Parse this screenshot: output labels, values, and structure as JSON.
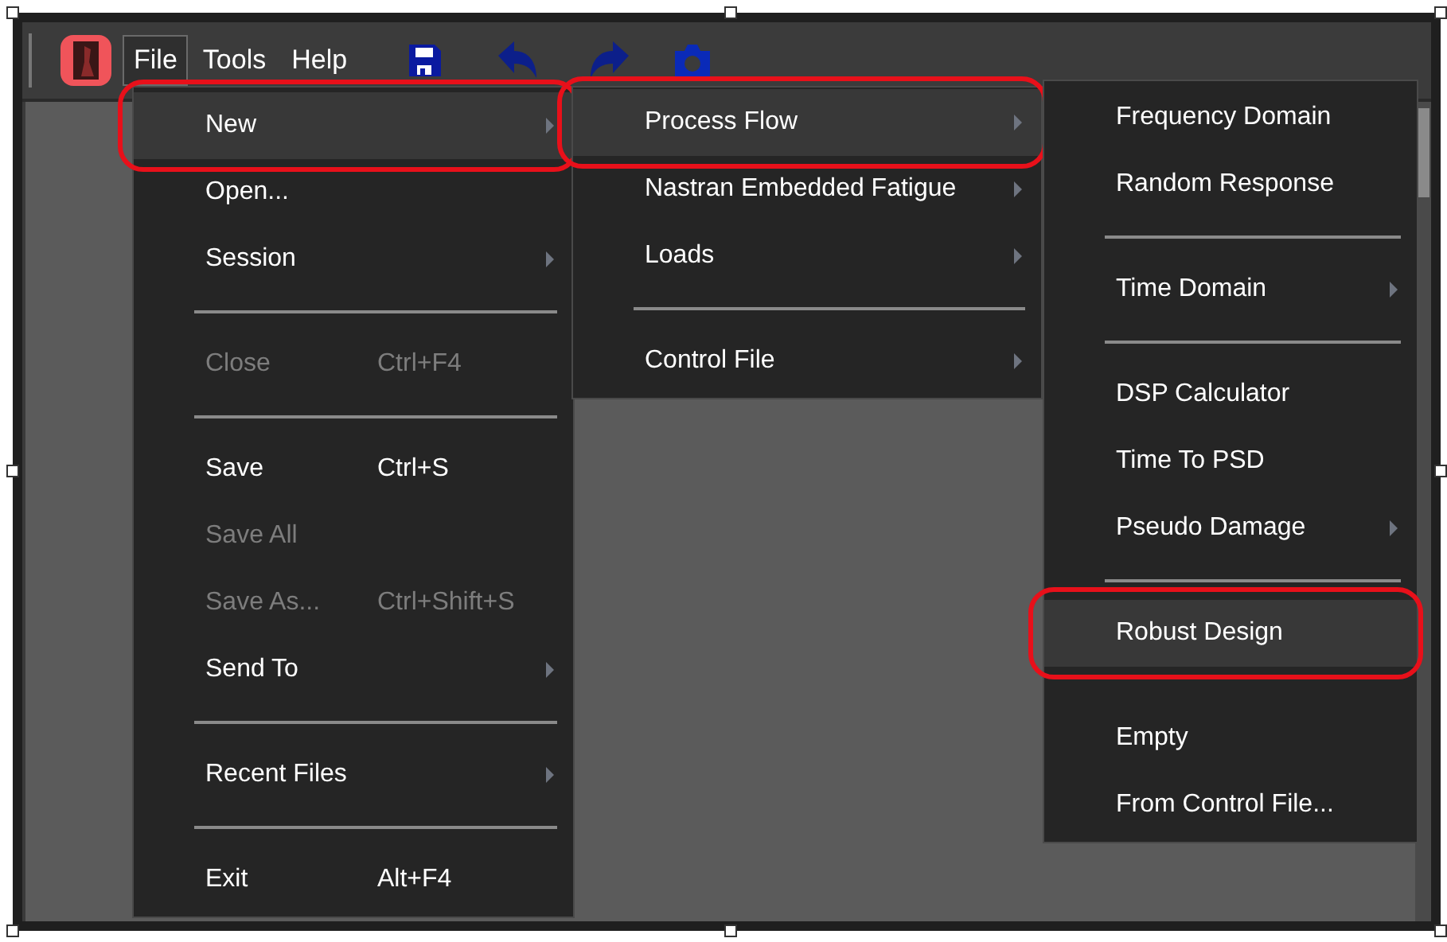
{
  "menu_bar": [
    {
      "label": "File",
      "selected": true
    },
    {
      "label": "Tools",
      "selected": false
    },
    {
      "label": "Help",
      "selected": false
    }
  ],
  "menus": [
    {
      "items": [
        {
          "kind": "item",
          "label": "New",
          "submenu": true,
          "disabled": false,
          "selected": true,
          "circled": true
        },
        {
          "kind": "item",
          "label": "Open...",
          "submenu": false,
          "disabled": false,
          "selected": false,
          "circled": false
        },
        {
          "kind": "item",
          "label": "Session",
          "submenu": true,
          "disabled": false,
          "selected": false,
          "circled": false
        },
        {
          "kind": "separator"
        },
        {
          "kind": "item",
          "label": "Close",
          "shortcut": "Ctrl+F4",
          "submenu": false,
          "disabled": true,
          "selected": false,
          "circled": false
        },
        {
          "kind": "separator"
        },
        {
          "kind": "item",
          "label": "Save",
          "shortcut": "Ctrl+S",
          "submenu": false,
          "disabled": false,
          "selected": false,
          "circled": false
        },
        {
          "kind": "item",
          "label": "Save All",
          "submenu": false,
          "disabled": true,
          "selected": false,
          "circled": false
        },
        {
          "kind": "item",
          "label": "Save As...",
          "shortcut": "Ctrl+Shift+S",
          "submenu": false,
          "disabled": true,
          "selected": false,
          "circled": false
        },
        {
          "kind": "item",
          "label": "Send To",
          "submenu": true,
          "disabled": false,
          "selected": false,
          "circled": false
        },
        {
          "kind": "separator"
        },
        {
          "kind": "item",
          "label": "Recent Files",
          "submenu": true,
          "disabled": false,
          "selected": false,
          "circled": false
        },
        {
          "kind": "separator"
        },
        {
          "kind": "item",
          "label": "Exit",
          "shortcut": "Alt+F4",
          "submenu": false,
          "disabled": false,
          "selected": false,
          "circled": false
        }
      ]
    },
    {
      "items": [
        {
          "kind": "item",
          "label": "Process Flow",
          "submenu": true,
          "disabled": false,
          "selected": true,
          "circled": true
        },
        {
          "kind": "item",
          "label": "Nastran Embedded Fatigue",
          "submenu": true,
          "disabled": false,
          "selected": false,
          "circled": false
        },
        {
          "kind": "item",
          "label": "Loads",
          "submenu": true,
          "disabled": false,
          "selected": false,
          "circled": false
        },
        {
          "kind": "separator"
        },
        {
          "kind": "item",
          "label": "Control File",
          "submenu": true,
          "disabled": false,
          "selected": false,
          "circled": false
        }
      ]
    },
    {
      "items": [
        {
          "kind": "item",
          "label": "Frequency Domain",
          "submenu": false,
          "disabled": false,
          "selected": false,
          "circled": false
        },
        {
          "kind": "item",
          "label": "Random Response",
          "submenu": false,
          "disabled": false,
          "selected": false,
          "circled": false
        },
        {
          "kind": "separator"
        },
        {
          "kind": "item",
          "label": "Time Domain",
          "submenu": true,
          "disabled": false,
          "selected": false,
          "circled": false
        },
        {
          "kind": "separator"
        },
        {
          "kind": "item",
          "label": "DSP Calculator",
          "submenu": false,
          "disabled": false,
          "selected": false,
          "circled": false
        },
        {
          "kind": "item",
          "label": "Time To PSD",
          "submenu": false,
          "disabled": false,
          "selected": false,
          "circled": false
        },
        {
          "kind": "item",
          "label": "Pseudo Damage",
          "submenu": true,
          "disabled": false,
          "selected": false,
          "circled": false
        },
        {
          "kind": "separator"
        },
        {
          "kind": "item",
          "label": "Robust Design",
          "submenu": false,
          "disabled": false,
          "selected": true,
          "circled": true
        },
        {
          "kind": "spacer"
        },
        {
          "kind": "item",
          "label": "Empty",
          "submenu": false,
          "disabled": false,
          "selected": false,
          "circled": false
        },
        {
          "kind": "item",
          "label": "From Control File...",
          "submenu": false,
          "disabled": false,
          "selected": false,
          "circled": false
        }
      ]
    }
  ]
}
